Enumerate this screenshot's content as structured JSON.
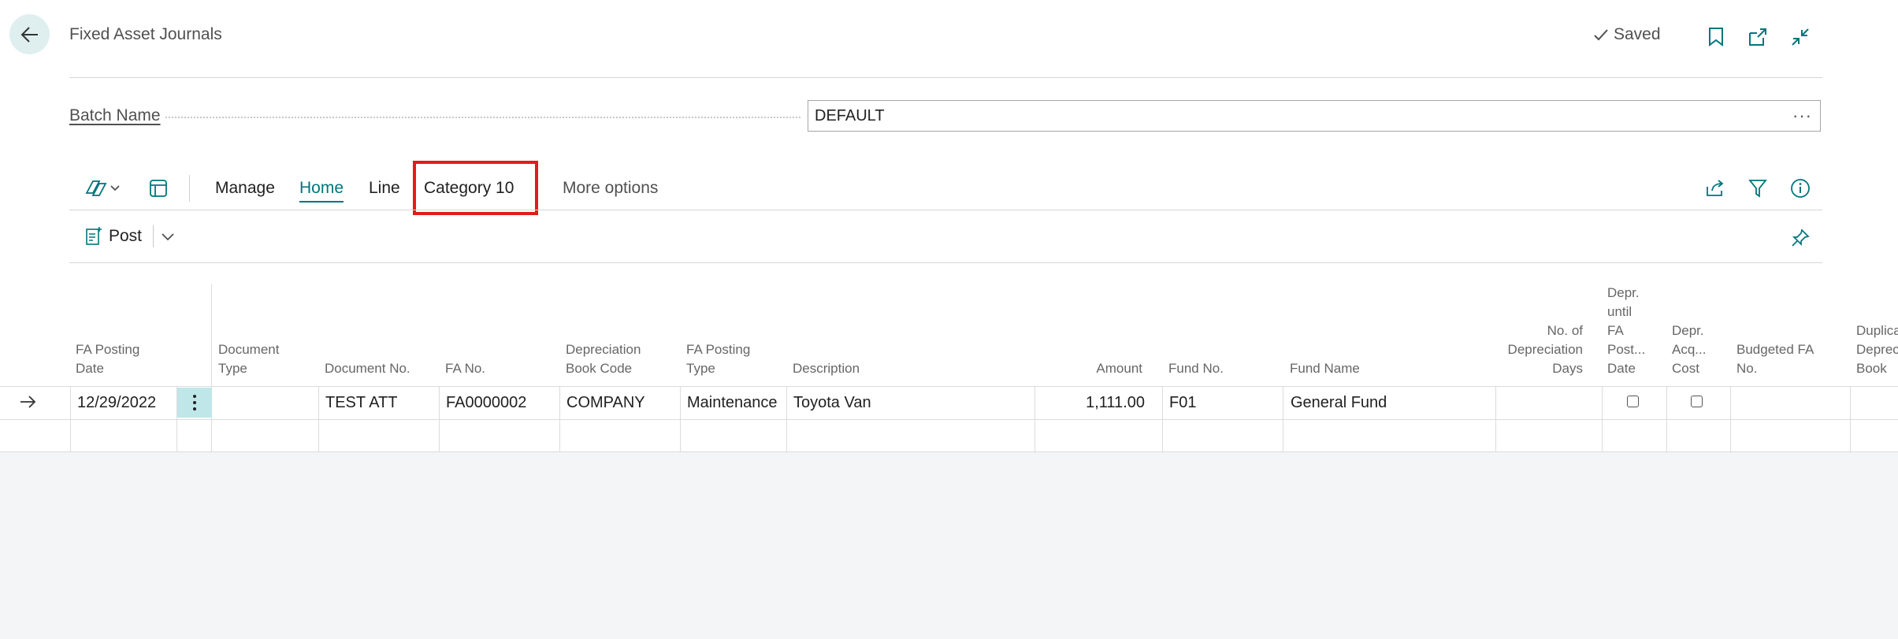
{
  "header": {
    "title": "Fixed Asset Journals",
    "saved_label": "Saved"
  },
  "batch": {
    "label": "Batch Name",
    "value": "DEFAULT",
    "more": "···"
  },
  "toolbar": {
    "tabs": [
      "Manage",
      "Home",
      "Line",
      "Category 10",
      "More options"
    ],
    "active_tab": "Home",
    "highlighted_tab": "Category 10"
  },
  "actions": {
    "post_label": "Post"
  },
  "grid": {
    "headers": {
      "fa_posting_date": [
        "FA Posting",
        "Date"
      ],
      "document_type": [
        "Document",
        "Type"
      ],
      "document_no": [
        "Document No."
      ],
      "fa_no": [
        "FA No."
      ],
      "depr_book_code": [
        "Depreciation",
        "Book Code"
      ],
      "fa_posting_type": [
        "FA Posting",
        "Type"
      ],
      "description": [
        "Description"
      ],
      "amount": [
        "Amount"
      ],
      "fund_no": [
        "Fund No."
      ],
      "fund_name": [
        "Fund Name"
      ],
      "no_depr_days": [
        "No. of",
        "Depreciation",
        "Days"
      ],
      "depr_until": [
        "Depr.",
        "until",
        "FA",
        "Post...",
        "Date"
      ],
      "depr_acq": [
        "Depr.",
        "Acq...",
        "Cost"
      ],
      "budgeted_fa": [
        "Budgeted FA",
        "No."
      ],
      "duplicate": [
        "Duplica",
        "Depreci",
        "Book"
      ]
    },
    "rows": [
      {
        "fa_posting_date": "12/29/2022",
        "document_type": "",
        "document_no": "TEST ATT",
        "fa_no": "FA0000002",
        "depr_book_code": "COMPANY",
        "fa_posting_type": "Maintenance",
        "description": "Toyota Van",
        "amount": "1,111.00",
        "fund_no": "F01",
        "fund_name": "General Fund",
        "depr_until_checked": false,
        "depr_acq_checked": false
      }
    ]
  },
  "colors": {
    "accent": "#00767b",
    "highlight": "#e21b1b",
    "back_bg": "#dfeff0"
  }
}
